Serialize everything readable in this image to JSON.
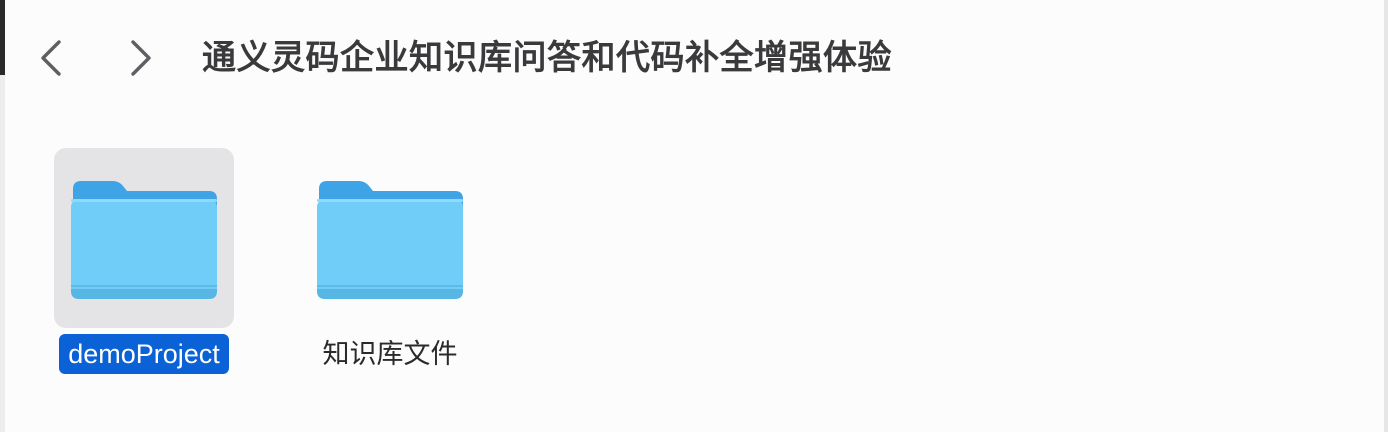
{
  "window": {
    "title": "通义灵码企业知识库问答和代码补全增强体验"
  },
  "navigation": {
    "back_icon": "chevron-left-icon",
    "forward_icon": "chevron-right-icon"
  },
  "items": [
    {
      "label": "demoProject",
      "icon": "folder-icon",
      "selected": true
    },
    {
      "label": "知识库文件",
      "icon": "folder-icon",
      "selected": false
    }
  ],
  "colors": {
    "selection": "#0a62d6",
    "folder_front": "#6fcdf8",
    "folder_back": "#3ea4e6",
    "title_text": "#3a3a3c"
  }
}
